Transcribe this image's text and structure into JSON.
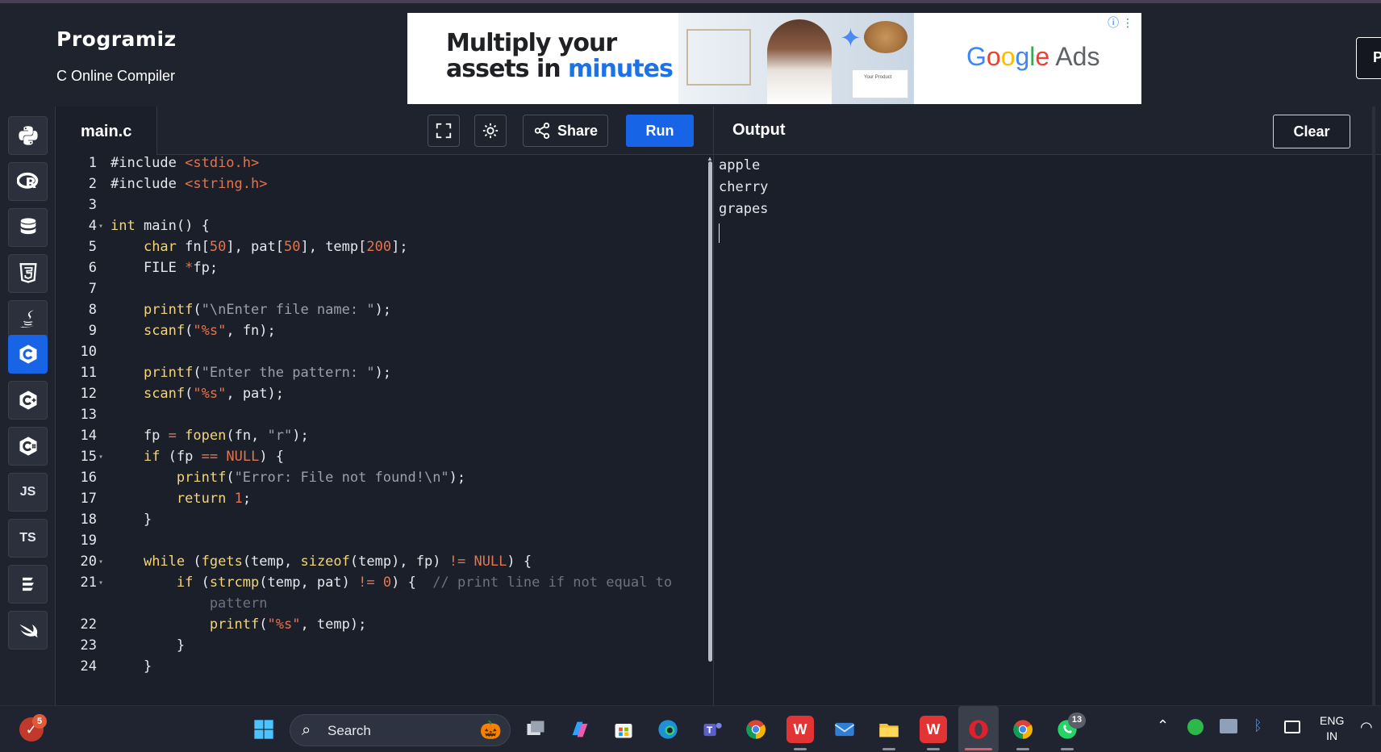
{
  "header": {
    "logo": "Programiz",
    "subtitle": "C Online Compiler",
    "cut_button_label": "P"
  },
  "ad": {
    "headline_line1": "Multiply your",
    "headline_line2_a": "assets in ",
    "headline_line2_b": "minutes",
    "brand": "Google Ads",
    "card_text": "Your Product"
  },
  "sidebar": {
    "languages": [
      {
        "name": "python",
        "label": ""
      },
      {
        "name": "r",
        "label": ""
      },
      {
        "name": "sql",
        "label": ""
      },
      {
        "name": "html",
        "label": ""
      },
      {
        "name": "java",
        "label": ""
      },
      {
        "name": "c",
        "label": "",
        "active": true
      },
      {
        "name": "cpp",
        "label": ""
      },
      {
        "name": "csharp",
        "label": ""
      },
      {
        "name": "javascript",
        "label": "JS"
      },
      {
        "name": "typescript",
        "label": "TS"
      },
      {
        "name": "go",
        "label": ""
      },
      {
        "name": "swift",
        "label": ""
      }
    ]
  },
  "editor": {
    "file_tab": "main.c",
    "share_label": "Share",
    "run_label": "Run",
    "lines": [
      {
        "n": "1",
        "fold": false
      },
      {
        "n": "2",
        "fold": false
      },
      {
        "n": "3",
        "fold": false
      },
      {
        "n": "4",
        "fold": true
      },
      {
        "n": "5",
        "fold": false
      },
      {
        "n": "6",
        "fold": false
      },
      {
        "n": "7",
        "fold": false
      },
      {
        "n": "8",
        "fold": false
      },
      {
        "n": "9",
        "fold": false
      },
      {
        "n": "10",
        "fold": false
      },
      {
        "n": "11",
        "fold": false
      },
      {
        "n": "12",
        "fold": false
      },
      {
        "n": "13",
        "fold": false
      },
      {
        "n": "14",
        "fold": false
      },
      {
        "n": "15",
        "fold": true
      },
      {
        "n": "16",
        "fold": false
      },
      {
        "n": "17",
        "fold": false
      },
      {
        "n": "18",
        "fold": false
      },
      {
        "n": "19",
        "fold": false
      },
      {
        "n": "20",
        "fold": true
      },
      {
        "n": "21",
        "fold": true
      },
      {
        "n": "",
        "fold": false
      },
      {
        "n": "22",
        "fold": false
      },
      {
        "n": "23",
        "fold": false
      },
      {
        "n": "24",
        "fold": false
      }
    ],
    "code": {
      "l1a": "#include ",
      "l1b": "<stdio.h>",
      "l2a": "#include ",
      "l2b": "<string.h>",
      "l4a": "int",
      "l4b": " main() {",
      "l5a": "    ",
      "l5b": "char",
      "l5c": " fn[",
      "l5d": "50",
      "l5e": "], pat[",
      "l5f": "50",
      "l5g": "], temp[",
      "l5h": "200",
      "l5i": "];",
      "l6a": "    FILE ",
      "l6b": "*",
      "l6c": "fp;",
      "l8a": "    ",
      "l8b": "printf",
      "l8c": "(",
      "l8d": "\"\\nEnter file name: \"",
      "l8e": ");",
      "l9a": "    ",
      "l9b": "scanf",
      "l9c": "(",
      "l9d": "\"%s\"",
      "l9e": ", fn);",
      "l11a": "    ",
      "l11b": "printf",
      "l11c": "(",
      "l11d": "\"Enter the pattern: \"",
      "l11e": ");",
      "l12a": "    ",
      "l12b": "scanf",
      "l12c": "(",
      "l12d": "\"%s\"",
      "l12e": ", pat);",
      "l14a": "    fp ",
      "l14b": "=",
      "l14c": " ",
      "l14d": "fopen",
      "l14e": "(fn, ",
      "l14f": "\"r\"",
      "l14g": ");",
      "l15a": "    ",
      "l15b": "if",
      "l15c": " (fp ",
      "l15d": "==",
      "l15e": " ",
      "l15f": "NULL",
      "l15g": ") {",
      "l16a": "        ",
      "l16b": "printf",
      "l16c": "(",
      "l16d": "\"Error: File not found!\\n\"",
      "l16e": ");",
      "l17a": "        ",
      "l17b": "return",
      "l17c": " ",
      "l17d": "1",
      "l17e": ";",
      "l18a": "    }",
      "l20a": "    ",
      "l20b": "while",
      "l20c": " (",
      "l20d": "fgets",
      "l20e": "(temp, ",
      "l20f": "sizeof",
      "l20g": "(temp), fp) ",
      "l20h": "!=",
      "l20i": " ",
      "l20j": "NULL",
      "l20k": ") {",
      "l21a": "        ",
      "l21b": "if",
      "l21c": " (",
      "l21d": "strcmp",
      "l21e": "(temp, pat) ",
      "l21f": "!=",
      "l21g": " ",
      "l21h": "0",
      "l21i": ") {  ",
      "l21j": "// print line if not equal to",
      "l21w": "            pattern",
      "l22a": "            ",
      "l22b": "printf",
      "l22c": "(",
      "l22d": "\"%s\"",
      "l22e": ", temp);",
      "l23a": "        }",
      "l24a": "    }"
    }
  },
  "output": {
    "title": "Output",
    "clear_label": "Clear",
    "lines": [
      "apple",
      "cherry",
      "grapes"
    ]
  },
  "taskbar": {
    "search_placeholder": "Search",
    "mail_badge": "5",
    "whatsapp_badge": "13",
    "lang_line1": "ENG",
    "lang_line2": "IN"
  }
}
